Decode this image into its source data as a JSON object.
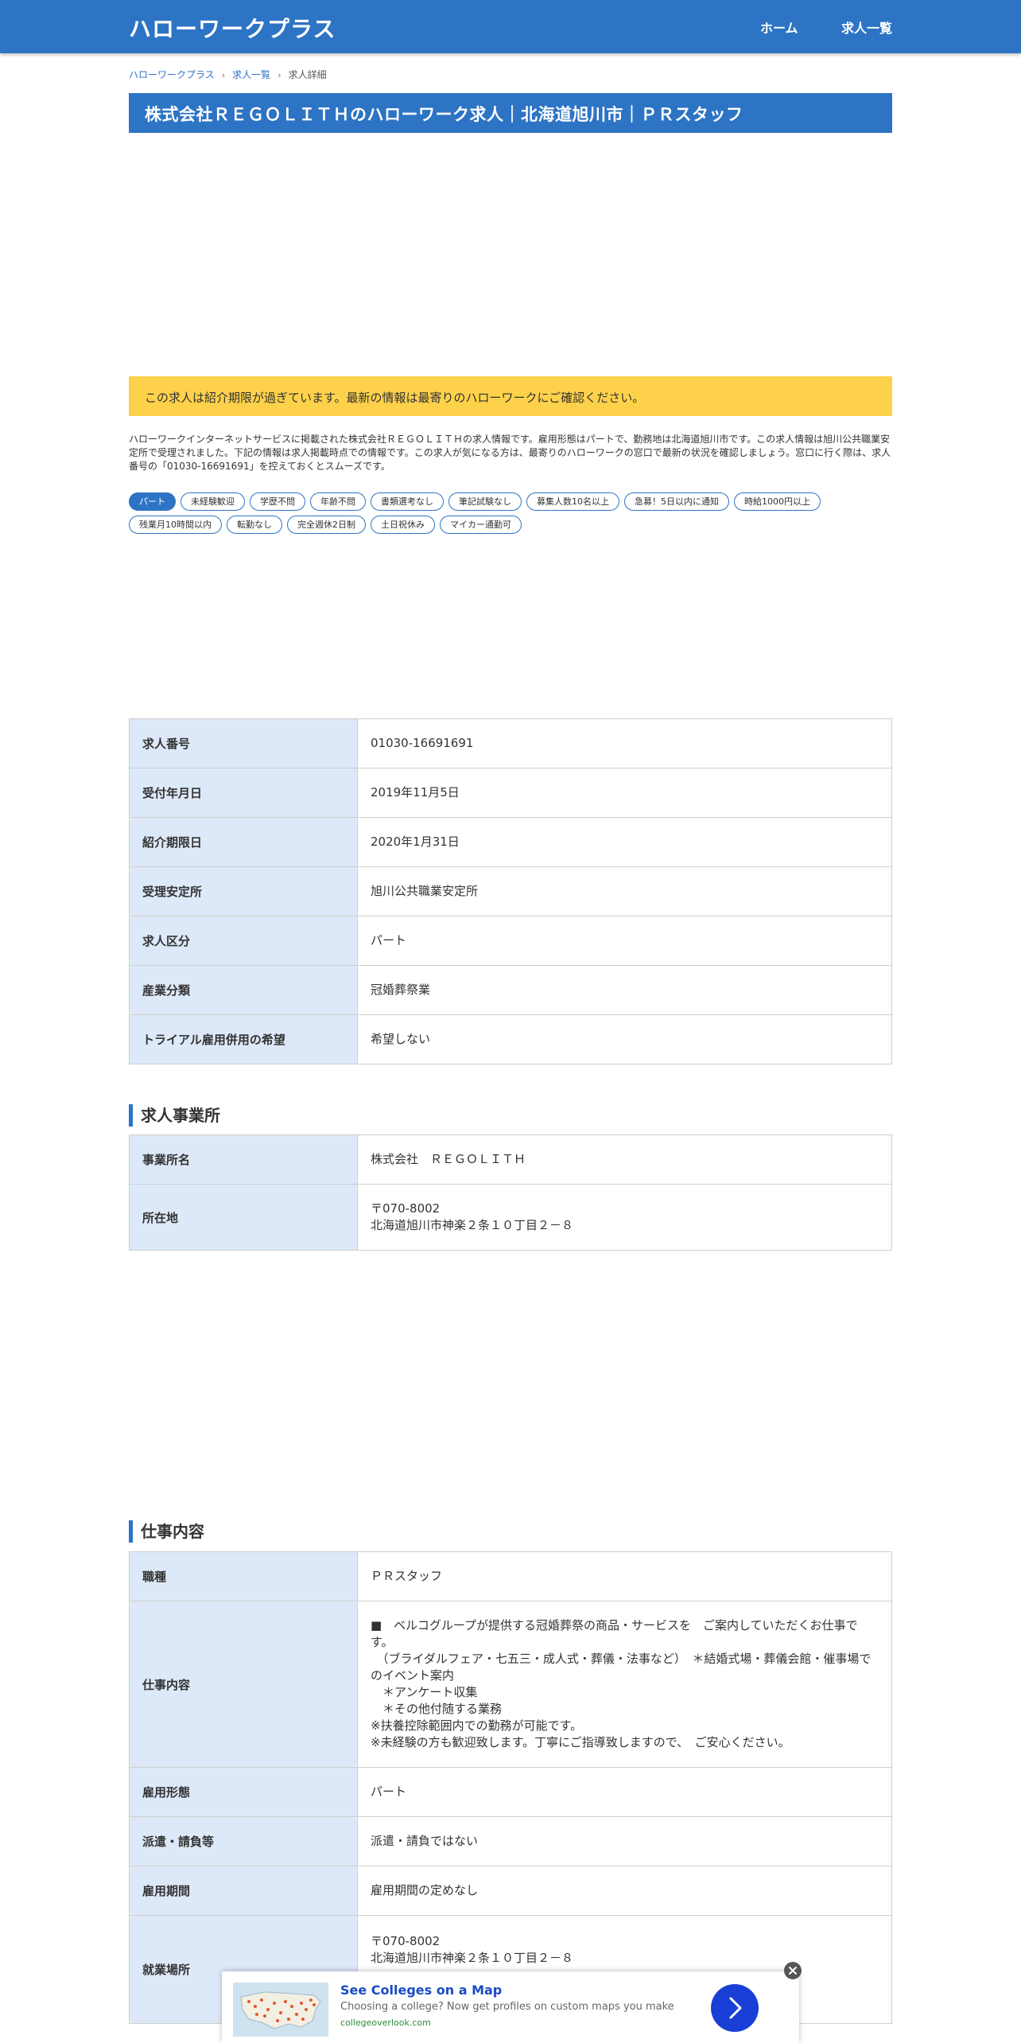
{
  "header": {
    "logo": "ハローワークプラス",
    "nav": [
      "ホーム",
      "求人一覧"
    ]
  },
  "breadcrumb": [
    "ハローワークプラス",
    "求人一覧",
    "求人詳細"
  ],
  "page_title": "株式会社ＲＥＧＯＬＩＴＨのハローワーク求人｜北海道旭川市｜ＰＲスタッフ",
  "notice": "この求人は紹介期限が過ぎています。最新の情報は最寄りのハローワークにご確認ください。",
  "description": "ハローワークインターネットサービスに掲載された株式会社ＲＥＧＯＬＩＴＨの求人情報です。雇用形態はパートで、勤務地は北海道旭川市です。この求人情報は旭川公共職業安定所で受理されました。下記の情報は求人掲載時点での情報です。この求人が気になる方は、最寄りのハローワークの窓口で最新の状況を確認しましょう。窓口に行く際は、求人番号の「01030-16691691」を控えておくとスムーズです。",
  "tags": [
    "パート",
    "未経験歓迎",
    "学歴不問",
    "年齢不問",
    "書類選考なし",
    "筆記試験なし",
    "募集人数10名以上",
    "急募！5日以内に通知",
    "時給1000円以上",
    "残業月10時間以内",
    "転勤なし",
    "完全週休2日制",
    "土日祝休み",
    "マイカー通勤可"
  ],
  "basic_info": [
    {
      "label": "求人番号",
      "value": "01030-16691691"
    },
    {
      "label": "受付年月日",
      "value": "2019年11月5日"
    },
    {
      "label": "紹介期限日",
      "value": "2020年1月31日"
    },
    {
      "label": "受理安定所",
      "value": "旭川公共職業安定所"
    },
    {
      "label": "求人区分",
      "value": "パート"
    },
    {
      "label": "産業分類",
      "value": "冠婚葬祭業"
    },
    {
      "label": "トライアル雇用併用の希望",
      "value": "希望しない"
    }
  ],
  "office_section": {
    "heading": "求人事業所",
    "rows": [
      {
        "label": "事業所名",
        "lines": [
          "株式会社　ＲＥＧＯＬＩＴＨ"
        ]
      },
      {
        "label": "所在地",
        "lines": [
          "〒070-8002",
          "北海道旭川市神楽２条１０丁目２－８"
        ]
      }
    ]
  },
  "job_section": {
    "heading": "仕事内容",
    "rows": [
      {
        "label": "職種",
        "lines": [
          "ＰＲスタッフ"
        ]
      },
      {
        "label": "仕事内容",
        "lines": [
          "■　ベルコグループが提供する冠婚葬祭の商品・サービスを　ご案内していただくお仕事です。",
          "　（ブライダルフェア・七五三・成人式・葬儀・法事など）　＊結婚式場・葬儀会館・催事場でのイベント案内",
          "　＊アンケート収集",
          "　＊その他付随する業務",
          "※扶養控除範囲内での勤務が可能です。",
          "※未経験の方も歓迎致します。丁寧にご指導致しますので、　ご安心ください。"
        ]
      },
      {
        "label": "雇用形態",
        "lines": [
          "パート"
        ]
      },
      {
        "label": "派遣・請負等",
        "lines": [
          "派遣・請負ではない"
        ]
      },
      {
        "label": "雇用期間",
        "lines": [
          "雇用期間の定めなし"
        ]
      },
      {
        "label": "就業場所",
        "lines": [
          "〒070-8002",
          "北海道旭川市神楽２条１０丁目２－８"
        ]
      }
    ]
  },
  "ad": {
    "title": "See Colleges on a Map",
    "description": "Choosing a college? Now get profiles on custom maps you make",
    "url": "collegeoverlook.com"
  },
  "colors": {
    "brand": "#2d74c4",
    "notice": "#fdd14a",
    "table_header": "#dde9f8"
  }
}
